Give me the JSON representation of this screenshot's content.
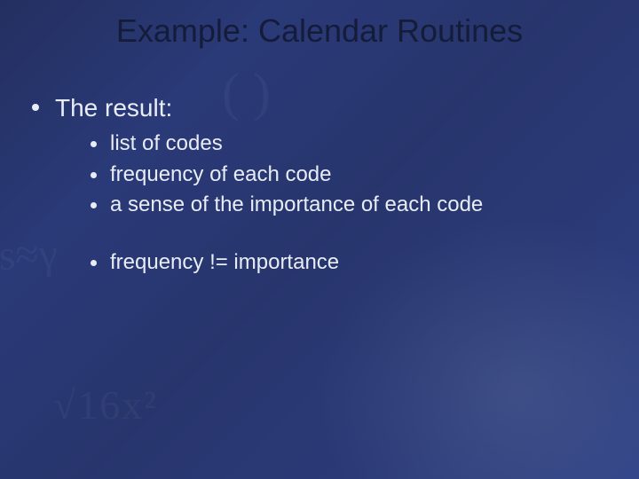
{
  "title": "Example: Calendar Routines",
  "level1": {
    "item0": "The result:"
  },
  "level2": {
    "groupA": {
      "i0": "list of codes",
      "i1": "frequency of each code",
      "i2": "a sense of the importance of each code"
    },
    "groupB": {
      "i0": "frequency != importance"
    }
  }
}
